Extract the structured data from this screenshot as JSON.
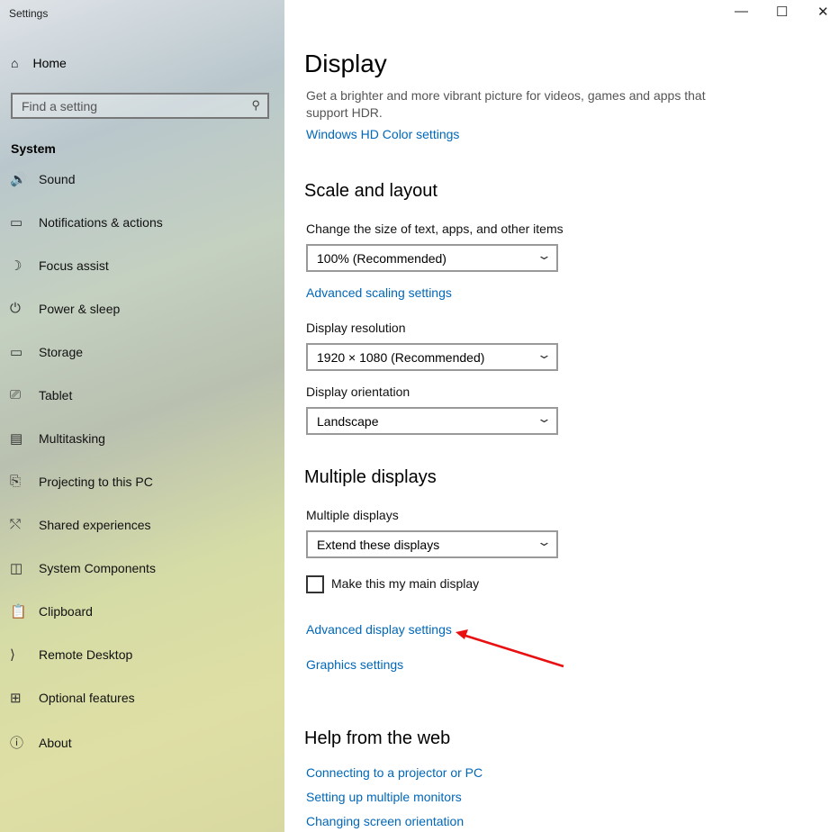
{
  "window": {
    "title": "Settings",
    "minimize": "—",
    "maximize": "☐",
    "close": "✕"
  },
  "sidebar": {
    "home": "Home",
    "search_placeholder": "Find a setting",
    "section": "System",
    "items": [
      {
        "label": "Sound",
        "icon": "🔊"
      },
      {
        "label": "Notifications & actions",
        "icon": "▭"
      },
      {
        "label": "Focus assist",
        "icon": "☽"
      },
      {
        "label": "Power & sleep",
        "icon": "⏻"
      },
      {
        "label": "Storage",
        "icon": "▭"
      },
      {
        "label": "Tablet",
        "icon": "⎚"
      },
      {
        "label": "Multitasking",
        "icon": "▤"
      },
      {
        "label": "Projecting to this PC",
        "icon": "⎘"
      },
      {
        "label": "Shared experiences",
        "icon": "⤲"
      },
      {
        "label": "System Components",
        "icon": "◫"
      },
      {
        "label": "Clipboard",
        "icon": "📋"
      },
      {
        "label": "Remote Desktop",
        "icon": "⟩"
      },
      {
        "label": "Optional features",
        "icon": "⊞"
      },
      {
        "label": "About",
        "icon": "ⓘ"
      }
    ]
  },
  "main": {
    "title": "Display",
    "hdr_desc": "Get a brighter and more vibrant picture for videos, games and apps that support HDR.",
    "hdr_link": "Windows HD Color settings",
    "scale_heading": "Scale and layout",
    "scale_label": "Change the size of text, apps, and other items",
    "scale_value": "100% (Recommended)",
    "adv_scaling": "Advanced scaling settings",
    "res_label": "Display resolution",
    "res_value": "1920 × 1080 (Recommended)",
    "orient_label": "Display orientation",
    "orient_value": "Landscape",
    "multi_heading": "Multiple displays",
    "multi_label": "Multiple displays",
    "multi_value": "Extend these displays",
    "main_display": "Make this my main display",
    "main_display_checked": false,
    "adv_display": "Advanced display settings",
    "graphics": "Graphics settings",
    "help_heading": "Help from the web",
    "help_links": [
      "Connecting to a projector or PC",
      "Setting up multiple monitors",
      "Changing screen orientation"
    ]
  },
  "annotation": {
    "arrow_color": "#e81010"
  }
}
